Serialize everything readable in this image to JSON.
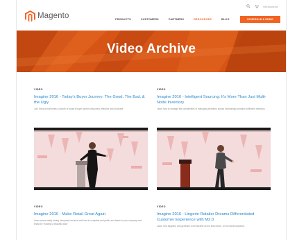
{
  "header": {
    "logo_text": "Magento",
    "search_text": "My Account",
    "nav": [
      {
        "label": "PRODUCTS",
        "active": false
      },
      {
        "label": "CUSTOMERS",
        "active": false
      },
      {
        "label": "PARTNERS",
        "active": false
      },
      {
        "label": "RESOURCES",
        "active": true
      },
      {
        "label": "BLOG",
        "active": false
      }
    ],
    "cta_label": "SCHEDULE A DEMO"
  },
  "hero": {
    "title": "Video Archive"
  },
  "cards": [
    {
      "tag": "VIDEO",
      "title": "Imagine 2016 - Today's Buyer Journey: The Good, The Bad, & the Ugly",
      "desc": "Join Erica as she peels a picture of today's buyer journey discovery, effective and purchase."
    },
    {
      "tag": "VIDEO",
      "title": "Imagine 2016 - Intelligent Sourcing: It's More Than Just Multi-Node Inventory",
      "desc": "Learn how to manage the complexities of managing inventory across increasingly complex fulfillment networks."
    },
    {
      "tag": "VIDEO",
      "title": "Imagine 2016 - Make Retail Great Again",
      "desc": "Learn where really daring, temporal concerns and how to complete and public and brave in your company and brand by \"building a beautiful wall.\""
    },
    {
      "tag": "VIDEO",
      "title": "Imagine 2016 - Lingerie Retailer Dreams Differentiated Customer Experience with M2.0",
      "desc": "Learn how adapted, and generate a memorable as the lived alone, on the latest customer."
    }
  ],
  "colors": {
    "accent": "#f26322",
    "link": "#2a86c7",
    "hero": "#d65416"
  }
}
